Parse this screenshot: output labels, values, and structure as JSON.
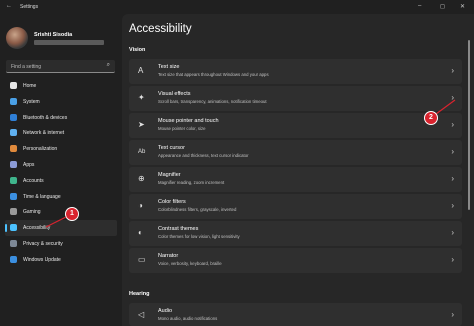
{
  "window": {
    "title": "Settings",
    "back_glyph": "←",
    "min_glyph": "–",
    "max_glyph": "◻",
    "close_glyph": "✕"
  },
  "user": {
    "name": "Srishti Sisodia"
  },
  "search": {
    "placeholder": "Find a setting",
    "icon": "search-icon"
  },
  "nav": [
    {
      "label": "Home",
      "icon": "home-icon",
      "color": "#e6e6e6"
    },
    {
      "label": "System",
      "icon": "monitor-icon",
      "color": "#4aa0e6"
    },
    {
      "label": "Bluetooth & devices",
      "icon": "bluetooth-icon",
      "color": "#2f7fd6"
    },
    {
      "label": "Network & internet",
      "icon": "wifi-icon",
      "color": "#5fb0f0"
    },
    {
      "label": "Personalization",
      "icon": "brush-icon",
      "color": "#e08a3c"
    },
    {
      "label": "Apps",
      "icon": "apps-icon",
      "color": "#8b9bd6"
    },
    {
      "label": "Accounts",
      "icon": "person-icon",
      "color": "#3fb58c"
    },
    {
      "label": "Time & language",
      "icon": "globe-clock-icon",
      "color": "#3b8fe0"
    },
    {
      "label": "Gaming",
      "icon": "gamepad-icon",
      "color": "#9a9a9a"
    },
    {
      "label": "Accessibility",
      "icon": "accessibility-icon",
      "color": "#4cc2ff"
    },
    {
      "label": "Privacy & security",
      "icon": "shield-icon",
      "color": "#7d8896"
    },
    {
      "label": "Windows Update",
      "icon": "update-icon",
      "color": "#3b8fe0"
    }
  ],
  "main": {
    "title": "Accessibility",
    "sections": {
      "vision": "Vision",
      "hearing": "Hearing"
    },
    "cards": [
      {
        "title": "Text size",
        "subtitle": "Text size that appears throughout Windows and your apps",
        "icon": "text-size-icon",
        "glyph": "A"
      },
      {
        "title": "Visual effects",
        "subtitle": "Scroll bars, transparency, animations, notification timeout",
        "icon": "sparkle-icon",
        "glyph": "✦"
      },
      {
        "title": "Mouse pointer and touch",
        "subtitle": "Mouse pointer color, size",
        "icon": "pointer-icon",
        "glyph": "➤"
      },
      {
        "title": "Text cursor",
        "subtitle": "Appearance and thickness, text cursor indicator",
        "icon": "text-cursor-icon",
        "glyph": "Ab"
      },
      {
        "title": "Magnifier",
        "subtitle": "Magnifier reading, zoom increment",
        "icon": "magnifier-icon",
        "glyph": "⊕"
      },
      {
        "title": "Color filters",
        "subtitle": "Colorblindness filters, grayscale, inverted",
        "icon": "color-filter-icon",
        "glyph": "◑"
      },
      {
        "title": "Contrast themes",
        "subtitle": "Color themes for low vision, light sensitivity",
        "icon": "contrast-icon",
        "glyph": "◐"
      },
      {
        "title": "Narrator",
        "subtitle": "Voice, verbosity, keyboard, braille",
        "icon": "narrator-icon",
        "glyph": "▭"
      },
      {
        "title": "Audio",
        "subtitle": "Mono audio, audio notifications",
        "icon": "speaker-icon",
        "glyph": "◁"
      }
    ],
    "chevron": "›"
  },
  "annotations": {
    "marker_1": "1",
    "marker_2": "2",
    "color": "#d9232e"
  }
}
